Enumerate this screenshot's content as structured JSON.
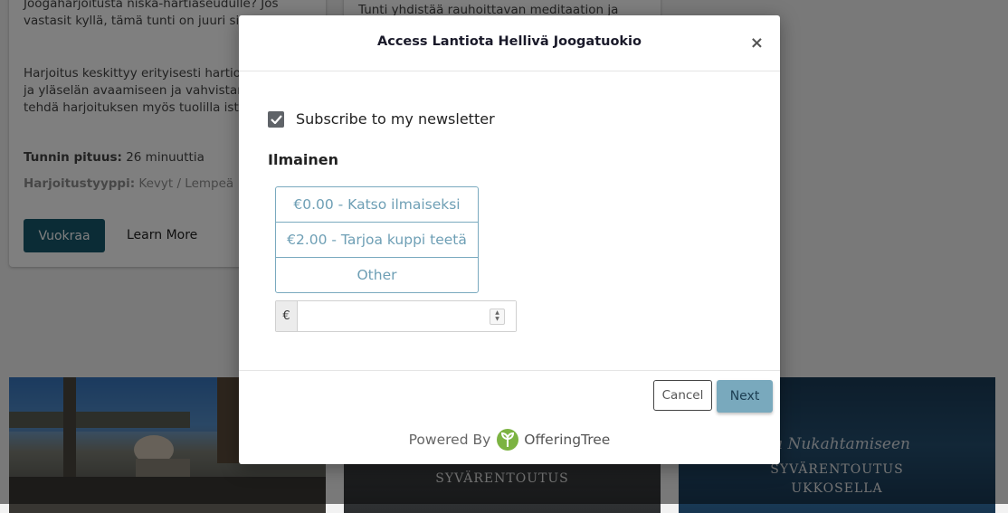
{
  "background": {
    "left_card": {
      "text_top_line1": "Joogaharjoitusta niska-hartiaseudulle? Jos",
      "text_top_line2": "vastasit kyllä, tämä tunti on juuri sinulle!",
      "desc_line1": "Harjoitus keskittyy erityisesti hartioiden",
      "desc_line2": "ja yläselän avaamiseen ja vahvistamiseen",
      "desc_line3": "tehdä harjoituksen myös tuolilla istuen.",
      "duration_label": "Tunnin pituus:",
      "duration_value": "26 minuuttia",
      "type_label": "Harjoitustyyppi:",
      "type_value": "Kevyt / Lempeä",
      "rent_button": "Vuokraa",
      "learn_more": "Learn More"
    },
    "mid_card": {
      "text_line1": "Tunti yhdistää rauhoittavan meditaation ja"
    },
    "thumbs": [
      {
        "caption": ""
      },
      {
        "caption": "SYVÄRENTOUTUS"
      },
      {
        "script_title": "ua Nukahtamiseen",
        "caption_line1": "SYVÄRENTOUTUS",
        "caption_line2": "UKKOSELLA"
      }
    ]
  },
  "modal": {
    "title": "Access Lantiota Hellivä Joogatuokio",
    "close_symbol": "×",
    "newsletter_label": "Subscribe to my newsletter",
    "newsletter_checked": true,
    "section_title": "Ilmainen",
    "options": [
      {
        "label": "€0.00 - Katso ilmaiseksi"
      },
      {
        "label": "€2.00 - Tarjoa kuppi teetä"
      },
      {
        "label": "Other"
      }
    ],
    "currency_symbol": "€",
    "amount_value": "",
    "cancel_label": "Cancel",
    "next_label": "Next",
    "powered_by": "Powered By",
    "brand_name": "OfferingTree"
  },
  "colors": {
    "accent": "#79a9bd",
    "option_text": "#6e9fb5",
    "brand_green": "#7cb342",
    "overlay": "rgba(0,0,0,0.5)"
  },
  "icons": {
    "close": "close-icon",
    "checkbox": "check-icon",
    "brand": "offeringtree-logo-icon",
    "spinner": "number-spinner-icon"
  }
}
